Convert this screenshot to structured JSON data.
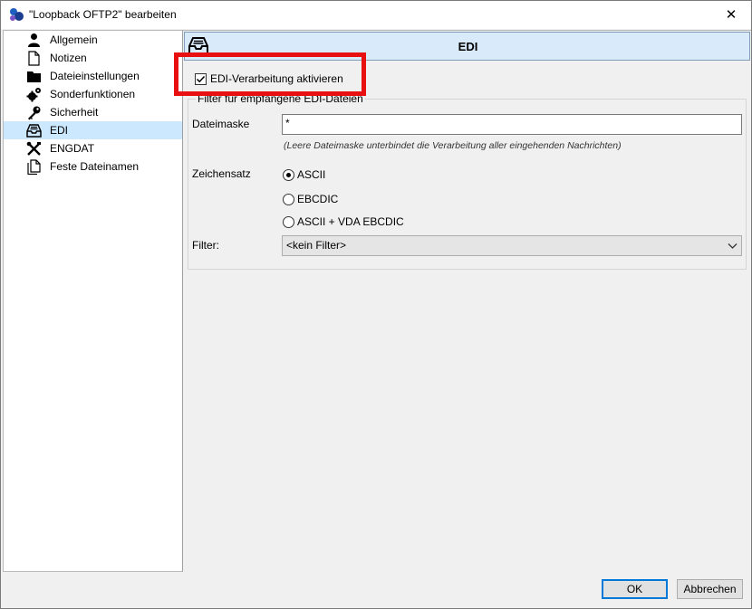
{
  "window": {
    "title": "\"Loopback OFTP2\" bearbeiten",
    "close_symbol": "✕"
  },
  "tree": {
    "items": [
      {
        "label": "Allgemein",
        "icon": "person-icon"
      },
      {
        "label": "Notizen",
        "icon": "document-icon"
      },
      {
        "label": "Dateieinstellungen",
        "icon": "folder-icon"
      },
      {
        "label": "Sonderfunktionen",
        "icon": "gears-icon"
      },
      {
        "label": "Sicherheit",
        "icon": "key-icon"
      },
      {
        "label": "EDI",
        "icon": "inbox-tray-icon",
        "selected": true
      },
      {
        "label": "ENGDAT",
        "icon": "tools-icon"
      },
      {
        "label": "Feste Dateinamen",
        "icon": "documents-icon"
      }
    ]
  },
  "panel": {
    "title": "EDI",
    "activate_label": "EDI-Verarbeitung aktivieren",
    "activate_checked": true,
    "group_title": "Filter für empfangene EDI-Dateien",
    "dateimaske_label": "Dateimaske",
    "dateimaske_value": "*",
    "dateimaske_hint": "(Leere Dateimaske unterbindet die Verarbeitung aller eingehenden Nachrichten)",
    "charset_label": "Zeichensatz",
    "charset_options": [
      "ASCII",
      "EBCDIC",
      "ASCII + VDA EBCDIC"
    ],
    "charset_selected": "ASCII",
    "filter_label": "Filter:",
    "filter_value": "<kein Filter>"
  },
  "buttons": {
    "ok": "OK",
    "cancel": "Abbrechen"
  },
  "colors": {
    "selection": "#cce8ff",
    "header_bg": "#d9ebfb",
    "highlight": "#e81010",
    "default_button_border": "#0078d7"
  }
}
